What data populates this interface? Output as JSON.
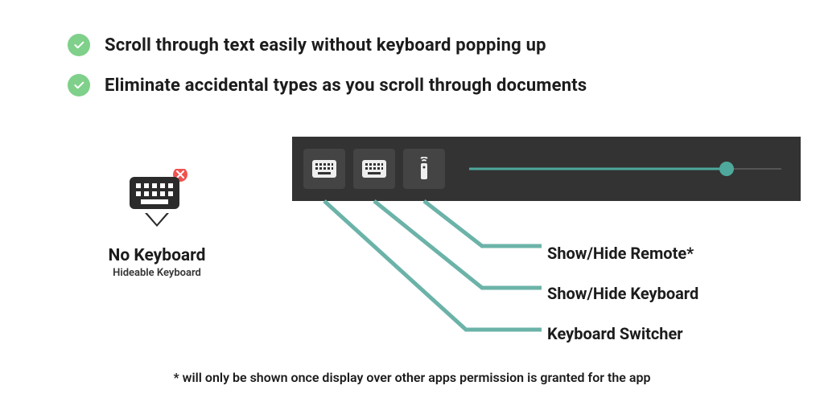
{
  "bullets": [
    "Scroll through text easily without keyboard popping up",
    "Eliminate accidental types as you scroll through documents"
  ],
  "app": {
    "title": "No Keyboard",
    "subtitle": "Hideable Keyboard"
  },
  "callouts": {
    "remote": "Show/Hide Remote*",
    "keyboard": "Show/Hide Keyboard",
    "switcher": "Keyboard Switcher"
  },
  "footnote": "* will only be shown once display over other apps permission is granted for the app",
  "colors": {
    "accent": "#4fa89c",
    "check": "#7fd08a",
    "close_badge": "#ef5350",
    "toolbar_bg": "#333333"
  }
}
